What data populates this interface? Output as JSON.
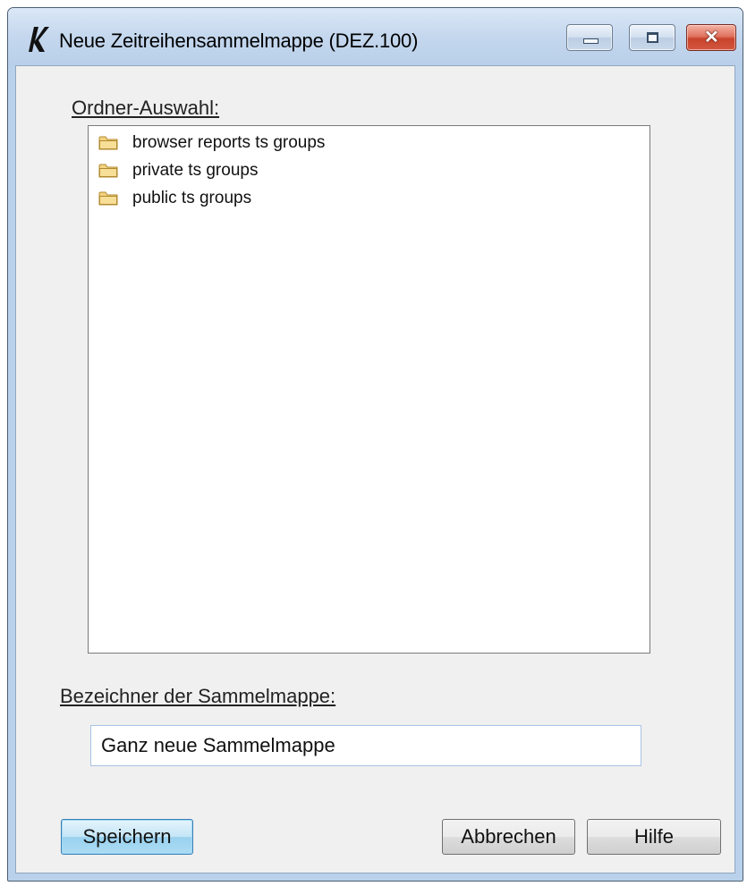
{
  "window": {
    "title": "Neue Zeitreihensammelmappe (DEZ.100)",
    "app_icon": "kappa-logo-icon",
    "controls": [
      "minimize-icon",
      "maximize-icon",
      "close-icon"
    ],
    "close_glyph": "✕"
  },
  "folder_section": {
    "label": "Ordner-Auswahl:",
    "items": [
      {
        "label": "browser reports ts groups",
        "icon": "folder-icon"
      },
      {
        "label": "private ts groups",
        "icon": "folder-icon"
      },
      {
        "label": "public ts groups",
        "icon": "folder-icon"
      }
    ]
  },
  "name_section": {
    "label": "Bezeichner der Sammelmappe:",
    "value": "Ganz neue Sammelmappe"
  },
  "buttons": {
    "save": "Speichern",
    "cancel": "Abbrechen",
    "help": "Hilfe"
  },
  "colors": {
    "window_frame": "#b9d1ea",
    "client_bg": "#f0f0f0",
    "close_button": "#c9432c",
    "default_button_accent": "#3c7fb1",
    "folder": "#f3d280"
  }
}
